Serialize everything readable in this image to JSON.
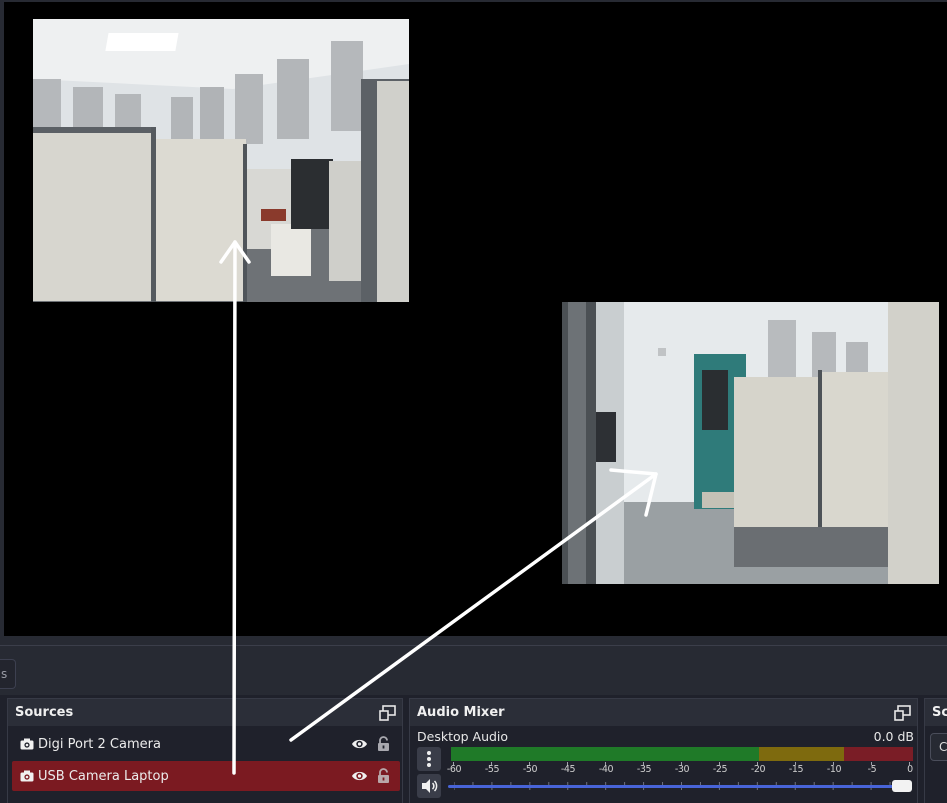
{
  "colors": {
    "background": "#1f212b",
    "selected_row": "#7b1a21",
    "meter_green": "#1f7a28",
    "meter_yellow": "#7e6a0e",
    "meter_red": "#7a1d26",
    "volume_accent": "#4864d8"
  },
  "preview": {
    "sources_shown": [
      "Digi Port 2 Camera",
      "USB Camera Laptop"
    ]
  },
  "band": {
    "tab_edge_label": "s"
  },
  "sources": {
    "title": "Sources",
    "items": [
      {
        "label": "Digi Port 2 Camera",
        "icon": "camera-icon",
        "visible": true,
        "locked": false,
        "selected": false
      },
      {
        "label": "USB Camera Laptop",
        "icon": "camera-icon",
        "visible": true,
        "locked": false,
        "selected": true
      }
    ]
  },
  "audio_mixer": {
    "title": "Audio Mixer",
    "channel": {
      "name": "Desktop Audio",
      "level": "0.0 dB",
      "volume_fraction": 1.0
    },
    "scale_labels": [
      "-60",
      "-55",
      "-50",
      "-45",
      "-40",
      "-35",
      "-30",
      "-25",
      "-20",
      "-15",
      "-10",
      "-5",
      "0"
    ]
  },
  "scene_transitions": {
    "title_partial": "Sc",
    "button_partial": "C"
  },
  "icons": [
    "dock-float-icon",
    "camera-icon",
    "eye-icon",
    "lock-icon",
    "menu-dots-icon",
    "speaker-icon"
  ]
}
